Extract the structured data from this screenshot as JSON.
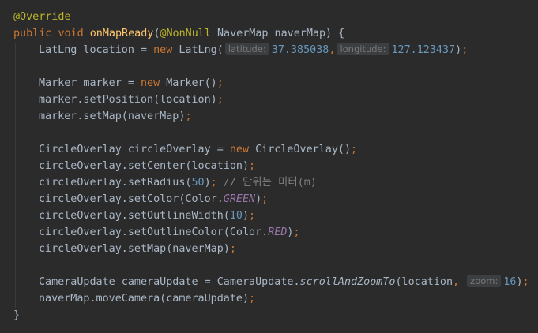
{
  "colors": {
    "background": "#2b2b2b",
    "annotation": "#bbb529",
    "keyword": "#cc7832",
    "method": "#ffc66d",
    "number": "#6897bb",
    "comment": "#808080",
    "field": "#9876aa",
    "text": "#a9b7c6"
  },
  "code": {
    "l1": {
      "annotation": "@Override"
    },
    "l2": {
      "kw1": "public",
      "kw2": "void",
      "method": "onMapReady",
      "paren_open": "(",
      "annotation": "@NonNull",
      "params": " NaverMap naverMap) {"
    },
    "l3": {
      "decl": "LatLng location = ",
      "kw_new": "new",
      "call": " LatLng(",
      "hint_latitude": "latitude:",
      "lat": "37.385038",
      "comma": ",",
      "hint_longitude": "longitude:",
      "lng": "127.123437",
      "close": ")",
      "semi": ";"
    },
    "l5": {
      "decl": "Marker marker = ",
      "kw_new": "new",
      "call": " Marker()",
      "semi": ";"
    },
    "l6": {
      "text": "marker.setPosition(location)",
      "semi": ";"
    },
    "l7": {
      "text": "marker.setMap(naverMap)",
      "semi": ";"
    },
    "l9": {
      "decl": "CircleOverlay circleOverlay = ",
      "kw_new": "new",
      "call": " CircleOverlay()",
      "semi": ";"
    },
    "l10": {
      "text": "circleOverlay.setCenter(location)",
      "semi": ";"
    },
    "l11": {
      "text": "circleOverlay.setRadius(",
      "num": "50",
      "close": ")",
      "semi": ";",
      "comment": " // 단위는 미터(m)"
    },
    "l12": {
      "text": "circleOverlay.setColor(Color.",
      "field": "GREEN",
      "close": ")",
      "semi": ";"
    },
    "l13": {
      "text": "circleOverlay.setOutlineWidth(",
      "num": "10",
      "close": ")",
      "semi": ";"
    },
    "l14": {
      "text": "circleOverlay.setOutlineColor(Color.",
      "field": "RED",
      "close": ")",
      "semi": ";"
    },
    "l15": {
      "text": "circleOverlay.setMap(naverMap)",
      "semi": ";"
    },
    "l17": {
      "decl": "CameraUpdate cameraUpdate = CameraUpdate.",
      "static_call": "scrollAndZoomTo",
      "args": "(location",
      "comma": ",",
      "hint_zoom": "zoom:",
      "num": "16",
      "close": ")",
      "semi": ";"
    },
    "l18": {
      "text": "naverMap.moveCamera(cameraUpdate)",
      "semi": ";"
    },
    "l19": {
      "text": "}"
    }
  }
}
